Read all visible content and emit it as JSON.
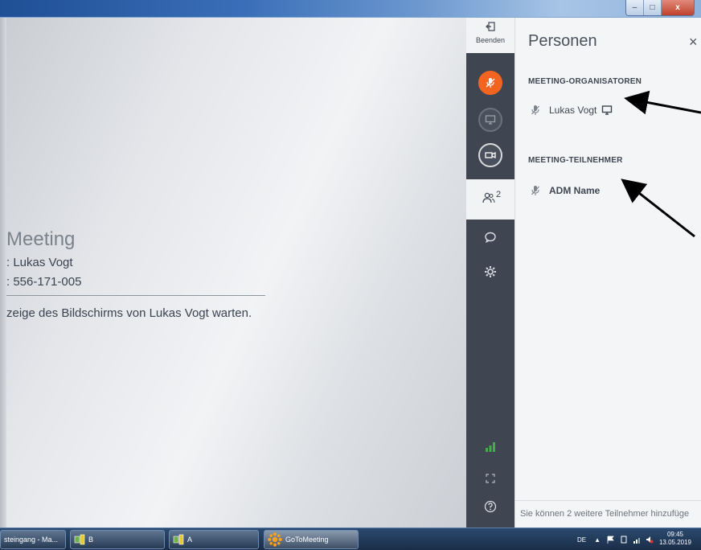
{
  "window": {
    "minimize": "–",
    "maximize": "□",
    "close": "x"
  },
  "main": {
    "title": "Meeting",
    "organizer_line": ": Lukas Vogt",
    "id_line": ": 556-171-005",
    "message": "zeige des Bildschirms von Lukas Vogt warten."
  },
  "toolbar": {
    "end_label": "Beenden",
    "people_count": "2",
    "mic_color": "#f36421",
    "signal_color": "#3cb043"
  },
  "panel": {
    "title": "Personen",
    "close": "×",
    "organizers_heading": "MEETING-ORGANISATOREN",
    "organizer_name": "Lukas Vogt",
    "participants_heading": "MEETING-TEILNEHMER",
    "participant_name": "ADM Name",
    "footer": "Sie können 2 weitere Teilnehmer hinzufüge"
  },
  "taskbar": {
    "items": [
      {
        "label": "steingang - Ma..."
      },
      {
        "label": "B"
      },
      {
        "label": "A"
      },
      {
        "label": "GoToMeeting"
      }
    ],
    "lang": "DE",
    "time": "09:45",
    "date": "13.05.2019"
  }
}
